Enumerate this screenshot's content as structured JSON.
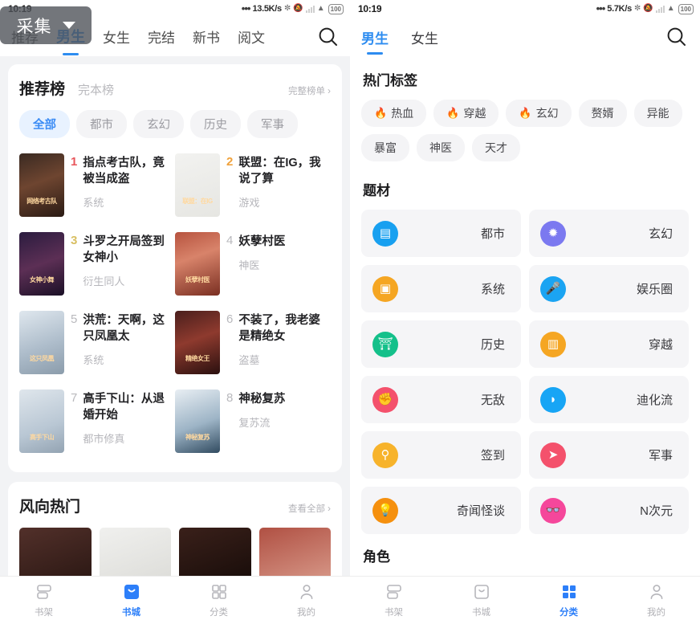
{
  "left": {
    "status": {
      "time": "10:19",
      "speed": "13.5K/s",
      "battery": "100"
    },
    "overlay": {
      "label": "采集",
      "caret": "chevron-down-icon"
    },
    "tabs": [
      {
        "label": "推荐",
        "active": false
      },
      {
        "label": "男生",
        "active": true
      },
      {
        "label": "女生",
        "active": false
      },
      {
        "label": "完结",
        "active": false
      },
      {
        "label": "新书",
        "active": false
      },
      {
        "label": "阅文",
        "active": false
      }
    ],
    "search_icon": "search-icon",
    "rank_card": {
      "title": "推荐榜",
      "subtitle": "完本榜",
      "more": "完整榜单",
      "chips": [
        {
          "label": "全部",
          "active": true
        },
        {
          "label": "都市",
          "active": false
        },
        {
          "label": "玄幻",
          "active": false
        },
        {
          "label": "历史",
          "active": false
        },
        {
          "label": "军事",
          "active": false
        }
      ],
      "books": [
        {
          "rank": "1",
          "title": "指点考古队，竟被当成盗",
          "category": "系统",
          "cover_bg": "linear-gradient(160deg,#3a2a22 0%,#6e4530 45%,#2a1b14 100%)",
          "cover_text": "网络考古队"
        },
        {
          "rank": "2",
          "title": "联盟：在IG，我说了算",
          "category": "游戏",
          "cover_bg": "linear-gradient(160deg,#f2f2f0 0%,#e6e6e2 100%)",
          "cover_text": "联盟：在IG"
        },
        {
          "rank": "3",
          "title": "斗罗之开局签到女神小",
          "category": "衍生同人",
          "cover_bg": "linear-gradient(160deg,#2b1c3f 0%,#5c2f55 50%,#1b1026 100%)",
          "cover_text": "女神小舞"
        },
        {
          "rank": "4",
          "title": "妖孽村医",
          "category": "神医",
          "cover_bg": "linear-gradient(160deg,#b7533f 0%,#d8836a 40%,#7a2f22 100%)",
          "cover_text": "妖孽村医"
        },
        {
          "rank": "5",
          "title": "洪荒：天啊，这只凤凰太",
          "category": "系统",
          "cover_bg": "linear-gradient(160deg,#dfe7ee 0%,#aebdcb 55%,#8b9cab 100%)",
          "cover_text": "这只凤凰"
        },
        {
          "rank": "6",
          "title": "不装了，我老婆是精绝女",
          "category": "盗墓",
          "cover_bg": "linear-gradient(160deg,#4a1f1d 0%,#8e3a2e 45%,#2a100f 100%)",
          "cover_text": "精绝女王"
        },
        {
          "rank": "7",
          "title": "高手下山：从退婚开始",
          "category": "都市修真",
          "cover_bg": "linear-gradient(160deg,#dfe6ec 0%,#b9c7d4 60%,#93a3b2 100%)",
          "cover_text": "高手下山"
        },
        {
          "rank": "8",
          "title": "神秘复苏",
          "category": "复苏流",
          "cover_bg": "linear-gradient(160deg,#e8eef3 0%,#9db4c6 55%,#314b60 100%)",
          "cover_text": "神秘复苏"
        }
      ]
    },
    "hot_card": {
      "title": "风向热门",
      "more": "查看全部",
      "thumbs": [
        {
          "bg": "linear-gradient(160deg,#52302a,#2a1713)"
        },
        {
          "bg": "linear-gradient(160deg,#f0f0ee,#dcdcd8)"
        },
        {
          "bg": "linear-gradient(160deg,#3a201a,#170c09)"
        },
        {
          "bg": "linear-gradient(160deg,#b05043,#d89a8a)"
        }
      ]
    },
    "nav": [
      {
        "label": "书架",
        "icon": "bookshelf-icon",
        "active": false
      },
      {
        "label": "书城",
        "icon": "bookstore-icon",
        "active": true
      },
      {
        "label": "分类",
        "icon": "category-icon",
        "active": false
      },
      {
        "label": "我的",
        "icon": "profile-icon",
        "active": false
      }
    ]
  },
  "right": {
    "status": {
      "time": "10:19",
      "speed": "5.7K/s",
      "battery": "100"
    },
    "tabs": [
      {
        "label": "男生",
        "active": true
      },
      {
        "label": "女生",
        "active": false
      }
    ],
    "search_icon": "search-icon",
    "hot_tags": {
      "title": "热门标签",
      "items": [
        {
          "label": "热血",
          "flame": true
        },
        {
          "label": "穿越",
          "flame": true
        },
        {
          "label": "玄幻",
          "flame": true
        },
        {
          "label": "赘婿",
          "flame": false
        },
        {
          "label": "异能",
          "flame": false
        },
        {
          "label": "暴富",
          "flame": false
        },
        {
          "label": "神医",
          "flame": false
        },
        {
          "label": "天才",
          "flame": false
        }
      ]
    },
    "themes": {
      "title": "题材",
      "items": [
        {
          "label": "都市",
          "icon": "building-icon",
          "glyph": "▤",
          "color": "#18a0f0"
        },
        {
          "label": "玄幻",
          "icon": "sparkle-icon",
          "glyph": "✹",
          "color": "#7b79f0"
        },
        {
          "label": "系统",
          "icon": "window-icon",
          "glyph": "▣",
          "color": "#f5a623"
        },
        {
          "label": "娱乐圈",
          "icon": "microphone-icon",
          "glyph": "🎤",
          "color": "#1ba4f2"
        },
        {
          "label": "历史",
          "icon": "temple-icon",
          "glyph": "⛩",
          "color": "#14c08a"
        },
        {
          "label": "穿越",
          "icon": "book-open-icon",
          "glyph": "▥",
          "color": "#f5a623"
        },
        {
          "label": "无敌",
          "icon": "fist-icon",
          "glyph": "✊",
          "color": "#f4516c"
        },
        {
          "label": "迪化流",
          "icon": "droplet-icon",
          "glyph": "◗",
          "color": "#17a5f5"
        },
        {
          "label": "签到",
          "icon": "pin-icon",
          "glyph": "⚲",
          "color": "#f7b32b"
        },
        {
          "label": "军事",
          "icon": "rocket-icon",
          "glyph": "➤",
          "color": "#f4516c"
        },
        {
          "label": "奇闻怪谈",
          "icon": "lightbulb-icon",
          "glyph": "💡",
          "color": "#f5900e"
        },
        {
          "label": "N次元",
          "icon": "mask-icon",
          "glyph": "👓",
          "color": "#f5479b"
        }
      ]
    },
    "next_section_title": "角色",
    "nav": [
      {
        "label": "书架",
        "icon": "bookshelf-icon",
        "active": false
      },
      {
        "label": "书城",
        "icon": "bookstore-icon",
        "active": false
      },
      {
        "label": "分类",
        "icon": "category-icon",
        "active": true
      },
      {
        "label": "我的",
        "icon": "profile-icon",
        "active": false
      }
    ]
  }
}
